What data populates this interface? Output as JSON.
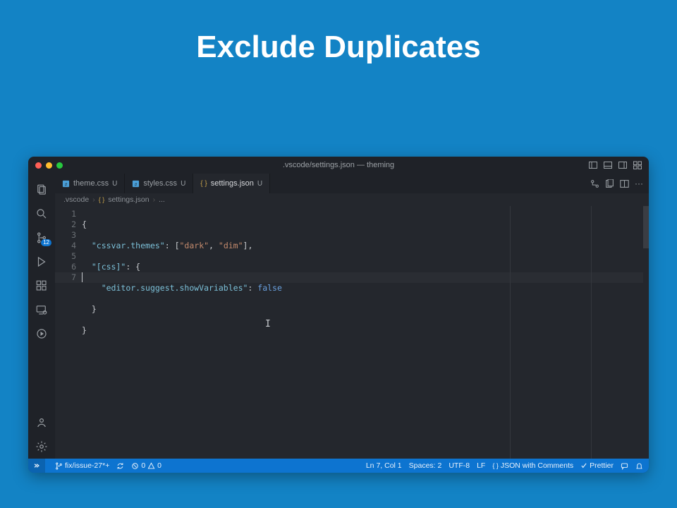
{
  "slide": {
    "title": "Exclude Duplicates"
  },
  "window": {
    "title": ".vscode/settings.json — theming"
  },
  "tabs": [
    {
      "label": "theme.css",
      "mod": "U",
      "icon": "css"
    },
    {
      "label": "styles.css",
      "mod": "U",
      "icon": "css"
    },
    {
      "label": "settings.json",
      "mod": "U",
      "icon": "json"
    }
  ],
  "breadcrumb": {
    "a": ".vscode",
    "b": "settings.json",
    "c": "..."
  },
  "code": {
    "lines": [
      "1",
      "2",
      "3",
      "4",
      "5",
      "6",
      "7"
    ],
    "l1_open": "{",
    "l2_key": "\"cssvar.themes\"",
    "l2_sep": ": [",
    "l2_v1": "\"dark\"",
    "l2_comma": ", ",
    "l2_v2": "\"dim\"",
    "l2_close": "],",
    "l3_key": "\"[css]\"",
    "l3_sep": ": {",
    "l4_key": "\"editor.suggest.showVariables\"",
    "l4_sep": ": ",
    "l4_val": "false",
    "l5_close": "}",
    "l6_close": "}"
  },
  "status": {
    "branch": "fix/issue-27*+",
    "errors": "0",
    "warnings": "0",
    "pos": "Ln 7, Col 1",
    "spaces": "Spaces: 2",
    "encoding": "UTF-8",
    "eol": "LF",
    "lang": "JSON with Comments",
    "formatter": "Prettier"
  },
  "activity": {
    "scm_badge": "12"
  }
}
